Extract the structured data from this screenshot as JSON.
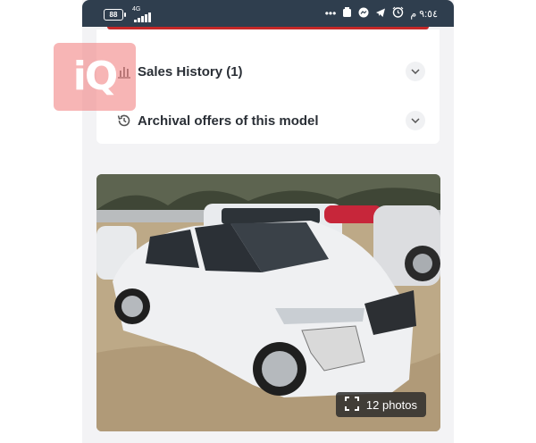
{
  "status_bar": {
    "battery": "88",
    "network": "4G",
    "time": "٩:٥٤ م"
  },
  "sections": {
    "sales_history": "Sales History (1)",
    "archival_offers": "Archival offers of this model"
  },
  "gallery": {
    "photos_label": "12 photos"
  },
  "watermark": {
    "text": "iQ"
  },
  "colors": {
    "status_bar": "#2f3e4e",
    "accent": "#c62828",
    "card": "#ffffff",
    "background": "#f3f3f5"
  }
}
